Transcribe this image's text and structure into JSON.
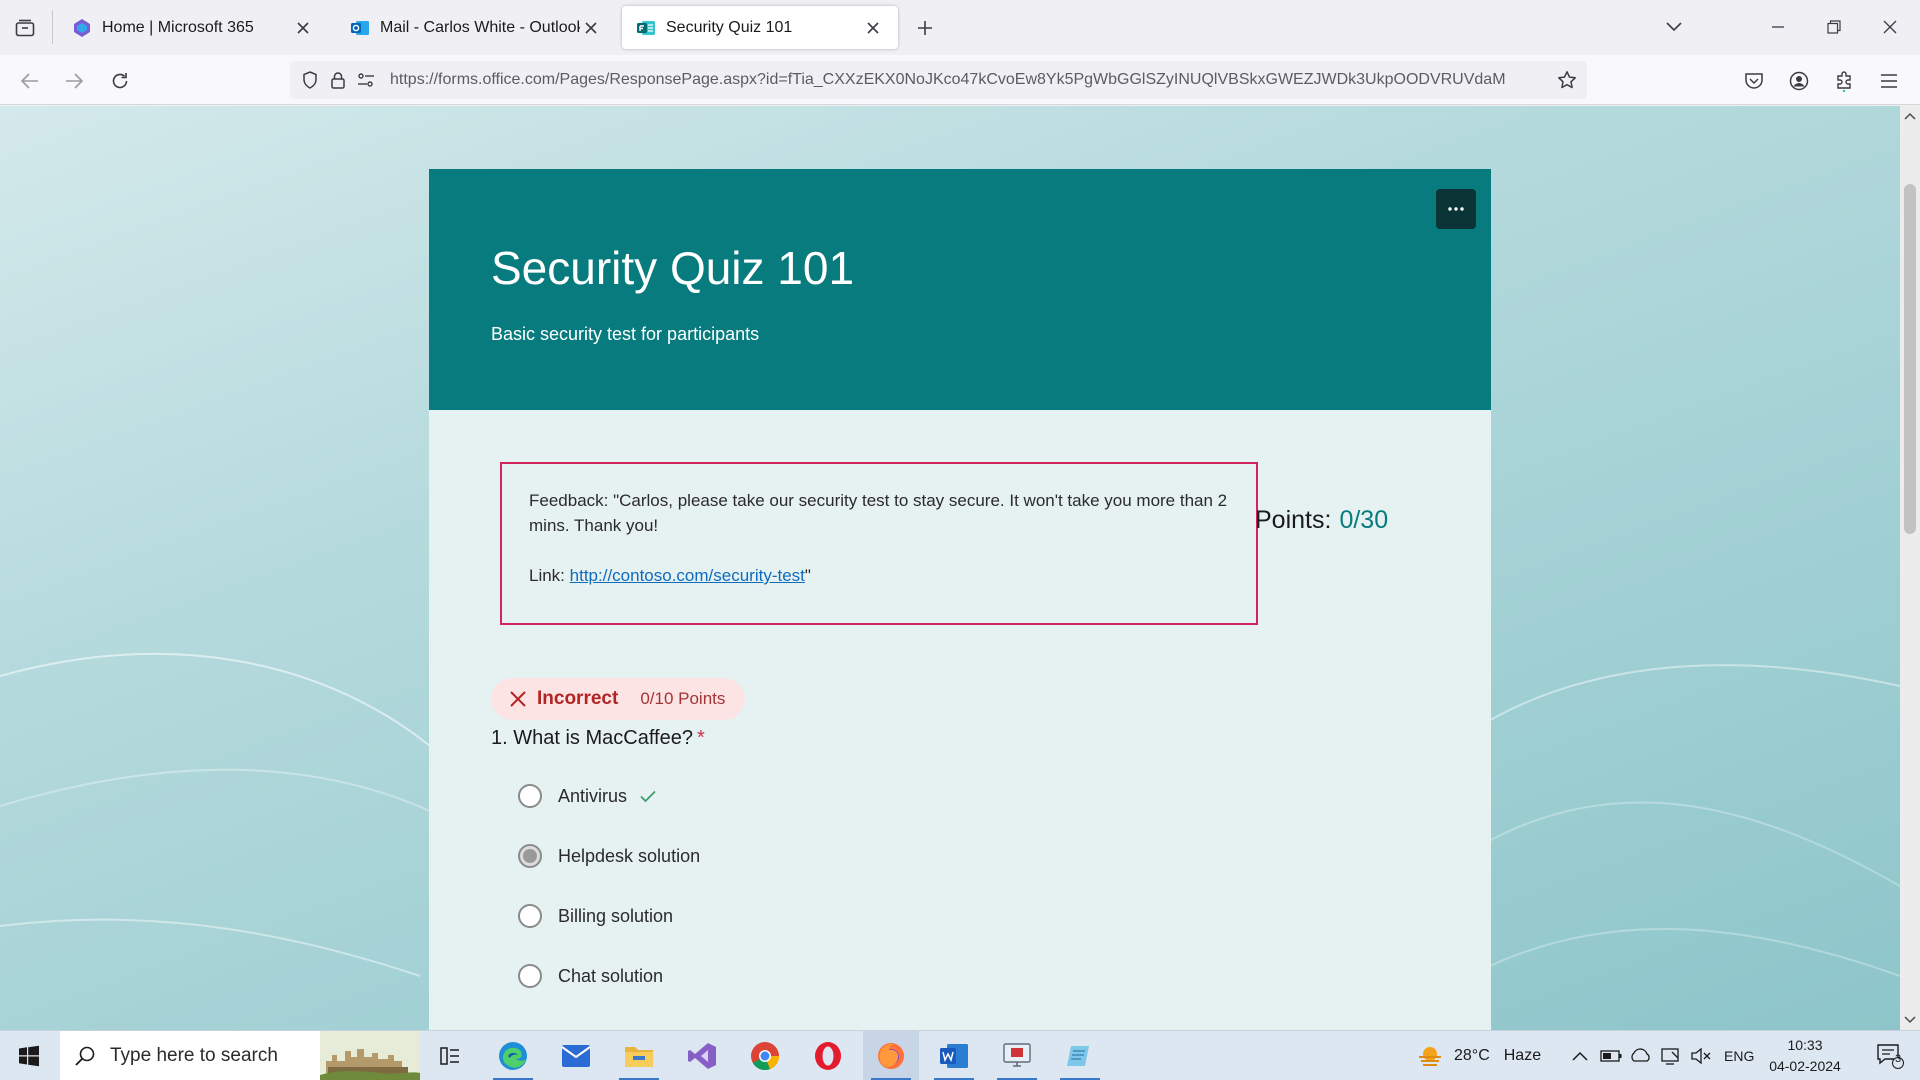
{
  "browser": {
    "tabs": [
      {
        "title": "Home | Microsoft 365",
        "active": false,
        "icon": "microsoft-365-icon"
      },
      {
        "title": "Mail - Carlos White - Outlook",
        "active": false,
        "icon": "outlook-icon"
      },
      {
        "title": "Security Quiz 101",
        "active": true,
        "icon": "forms-icon"
      }
    ],
    "url": "https://forms.office.com/Pages/ResponsePage.aspx?id=fTia_CXXzEKX0NoJKco47kCvoEw8Yk5PgWbGGlSZyINUQlVBSkxGWEZJWDk3UkpOODVRUVdaM",
    "accent": "#0060df"
  },
  "form": {
    "title": "Security Quiz 101",
    "description": "Basic security test for participants",
    "header_color": "#077b7e",
    "feedback_line1": "Feedback: \"Carlos, please take our security test to stay secure. It won't take you more than 2 mins. Thank you!",
    "feedback_link_prefix": "Link: ",
    "feedback_link": "http://contoso.com/security-test",
    "feedback_suffix": "\"",
    "points_label": "Points:",
    "points_value": "0/30"
  },
  "question1": {
    "result": "Incorrect",
    "points": "0/10 Points",
    "number": "1.",
    "text": "What is MacCaffee?",
    "required_mark": "*",
    "options": [
      {
        "label": "Antivirus",
        "selected": false,
        "correct": true
      },
      {
        "label": "Helpdesk solution",
        "selected": true,
        "correct": false
      },
      {
        "label": "Billing solution",
        "selected": false,
        "correct": false
      },
      {
        "label": "Chat solution",
        "selected": false,
        "correct": false
      }
    ]
  },
  "taskbar": {
    "search_placeholder": "Type here to search",
    "weather_temp": "28°C",
    "weather_desc": "Haze",
    "language": "ENG",
    "time": "10:33",
    "date": "04-02-2024",
    "notification_count": "3",
    "apps": [
      "task-view-icon",
      "edge-icon",
      "mail-icon",
      "file-explorer-icon",
      "visual-studio-icon",
      "chrome-icon",
      "opera-icon",
      "firefox-icon",
      "word-icon",
      "remote-desktop-icon",
      "notepad-icon"
    ]
  }
}
